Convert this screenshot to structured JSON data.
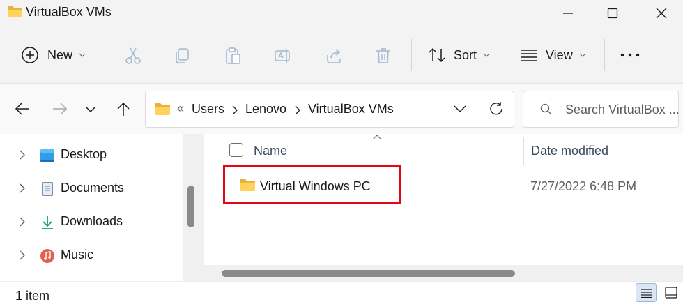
{
  "window": {
    "title": "VirtualBox VMs",
    "minimize_icon": "minimize-icon",
    "maximize_icon": "maximize-icon",
    "close_icon": "close-icon"
  },
  "toolbar": {
    "new_label": "New",
    "sort_label": "Sort",
    "view_label": "View",
    "icons": [
      "plus-circle-icon",
      "cut-icon",
      "copy-icon",
      "paste-icon",
      "rename-icon",
      "share-icon",
      "delete-icon",
      "sort-icon",
      "view-lines-icon",
      "more-icon"
    ]
  },
  "navigation": {
    "back_icon": "back-arrow-icon",
    "forward_icon": "forward-arrow-icon",
    "recent_icon": "chevron-down-icon",
    "up_icon": "up-arrow-icon",
    "address": {
      "overflow": "«",
      "crumbs": [
        "Users",
        "Lenovo",
        "VirtualBox VMs"
      ]
    },
    "search_placeholder": "Search VirtualBox ..."
  },
  "sidebar": {
    "items": [
      {
        "label": "Desktop",
        "icon": "desktop-icon"
      },
      {
        "label": "Documents",
        "icon": "documents-icon"
      },
      {
        "label": "Downloads",
        "icon": "downloads-icon"
      },
      {
        "label": "Music",
        "icon": "music-icon"
      }
    ]
  },
  "file_list": {
    "columns": {
      "name": "Name",
      "date_modified": "Date modified"
    },
    "items": [
      {
        "name": "Virtual Windows PC",
        "date_modified": "7/27/2022 6:48 PM",
        "type": "folder"
      }
    ]
  },
  "status": {
    "item_count": "1 item"
  },
  "colors": {
    "highlight_border": "#e30613",
    "folder_yellow": "#ffd35a",
    "chrome_bg": "#f3f3f3"
  }
}
